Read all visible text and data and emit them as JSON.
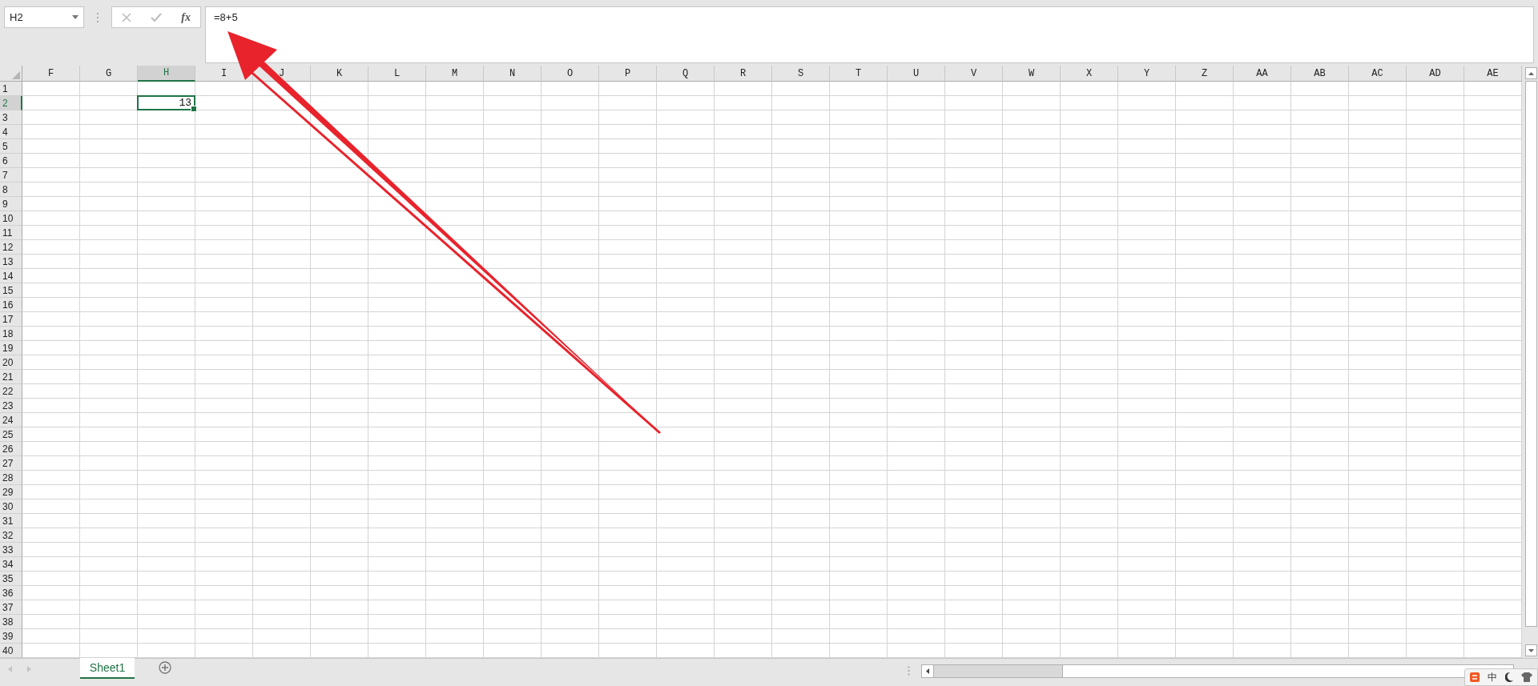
{
  "formula_bar": {
    "name_box": "H2",
    "function_label": "fx",
    "formula": "=8+5"
  },
  "grid": {
    "columns": [
      {
        "label": "F",
        "selected": false
      },
      {
        "label": "G",
        "selected": false
      },
      {
        "label": "H",
        "selected": true
      },
      {
        "label": "I",
        "selected": false
      },
      {
        "label": "J",
        "selected": false
      },
      {
        "label": "K",
        "selected": false
      },
      {
        "label": "L",
        "selected": false
      },
      {
        "label": "M",
        "selected": false
      },
      {
        "label": "N",
        "selected": false
      },
      {
        "label": "O",
        "selected": false
      },
      {
        "label": "P",
        "selected": false
      },
      {
        "label": "Q",
        "selected": false
      },
      {
        "label": "R",
        "selected": false
      },
      {
        "label": "S",
        "selected": false
      },
      {
        "label": "T",
        "selected": false
      },
      {
        "label": "U",
        "selected": false
      },
      {
        "label": "V",
        "selected": false
      },
      {
        "label": "W",
        "selected": false
      },
      {
        "label": "X",
        "selected": false
      },
      {
        "label": "Y",
        "selected": false
      },
      {
        "label": "Z",
        "selected": false
      },
      {
        "label": "AA",
        "selected": false
      },
      {
        "label": "AB",
        "selected": false
      },
      {
        "label": "AC",
        "selected": false
      },
      {
        "label": "AD",
        "selected": false
      },
      {
        "label": "AE",
        "selected": false
      }
    ],
    "rows": [
      {
        "label": "1",
        "selected": false
      },
      {
        "label": "2",
        "selected": true
      },
      {
        "label": "3",
        "selected": false
      },
      {
        "label": "4",
        "selected": false
      },
      {
        "label": "5",
        "selected": false
      },
      {
        "label": "6",
        "selected": false
      },
      {
        "label": "7",
        "selected": false
      },
      {
        "label": "8",
        "selected": false
      },
      {
        "label": "9",
        "selected": false
      },
      {
        "label": "10",
        "selected": false
      },
      {
        "label": "11",
        "selected": false
      },
      {
        "label": "12",
        "selected": false
      },
      {
        "label": "13",
        "selected": false
      },
      {
        "label": "14",
        "selected": false
      },
      {
        "label": "15",
        "selected": false
      },
      {
        "label": "16",
        "selected": false
      },
      {
        "label": "17",
        "selected": false
      },
      {
        "label": "18",
        "selected": false
      },
      {
        "label": "19",
        "selected": false
      },
      {
        "label": "20",
        "selected": false
      },
      {
        "label": "21",
        "selected": false
      },
      {
        "label": "22",
        "selected": false
      },
      {
        "label": "23",
        "selected": false
      },
      {
        "label": "24",
        "selected": false
      },
      {
        "label": "25",
        "selected": false
      },
      {
        "label": "26",
        "selected": false
      },
      {
        "label": "27",
        "selected": false
      },
      {
        "label": "28",
        "selected": false
      },
      {
        "label": "29",
        "selected": false
      },
      {
        "label": "30",
        "selected": false
      },
      {
        "label": "31",
        "selected": false
      },
      {
        "label": "32",
        "selected": false
      },
      {
        "label": "33",
        "selected": false
      },
      {
        "label": "34",
        "selected": false
      },
      {
        "label": "35",
        "selected": false
      },
      {
        "label": "36",
        "selected": false
      },
      {
        "label": "37",
        "selected": false
      },
      {
        "label": "38",
        "selected": false
      },
      {
        "label": "39",
        "selected": false
      },
      {
        "label": "40",
        "selected": false
      }
    ],
    "selected_cell_value": "13"
  },
  "sheet_tabs": [
    {
      "label": "Sheet1",
      "selected": true
    }
  ],
  "ime_toolbar": {
    "mode": "中"
  }
}
